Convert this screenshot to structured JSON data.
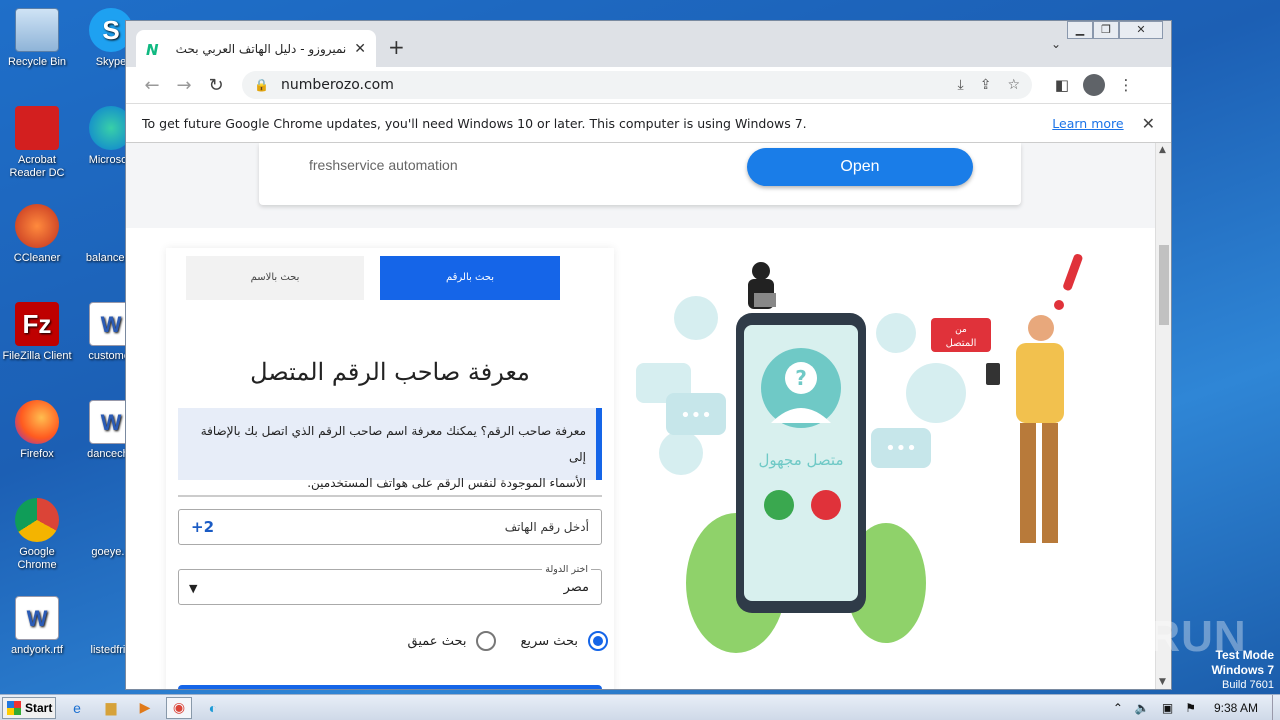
{
  "desktop": {
    "icons": [
      {
        "label": "Recycle Bin"
      },
      {
        "label": "Skype"
      },
      {
        "label": "Acrobat Reader DC"
      },
      {
        "label": "Microsoft"
      },
      {
        "label": "CCleaner"
      },
      {
        "label": "balanceco"
      },
      {
        "label": "FileZilla Client"
      },
      {
        "label": "customer"
      },
      {
        "label": "Firefox"
      },
      {
        "label": "danceche"
      },
      {
        "label": "Google Chrome"
      },
      {
        "label": "goeye.p"
      },
      {
        "label": "andyork.rtf"
      },
      {
        "label": "listedfrid"
      }
    ]
  },
  "browser": {
    "tab_title": "نميروزو - دليل الهاتف العربي بحث بالا",
    "tab_favicon": "N",
    "url": "numberozo.com",
    "infobar": {
      "message": "To get future Google Chrome updates, you'll need Windows 10 or later. This computer is using Windows 7.",
      "link": "Learn more"
    }
  },
  "ad": {
    "text": "freshservice automation",
    "button": "Open"
  },
  "search_card": {
    "tab_by_name": "بحث بالاسم",
    "tab_by_number": "بحث بالرقم",
    "heading": "معرفة صاحب الرقم المتصل",
    "info_line1": "معرفة صاحب الرقم؟ يمكنك معرفة اسم صاحب الرقم الذي اتصل بك بالإضافة إلى",
    "info_line2": "الأسماء الموجودة لنفس الرقم على هواتف المستخدمين.",
    "phone_placeholder": "أدخل رقم الهاتف",
    "phone_code": "+2",
    "country_label": "اختر الدولة",
    "country_value": "مصر",
    "radio_quick": "بحث سريع",
    "radio_deep": "بحث عميق",
    "selected_mode": "quick"
  },
  "illustration": {
    "phone_label": "متصل مجهول",
    "bubble_label_line1": "من",
    "bubble_label_line2": "المتصل"
  },
  "taskbar": {
    "start_label": "Start",
    "clock": "9:38 AM"
  },
  "os_watermark": {
    "line1": "Test Mode",
    "line2": "Windows 7",
    "line3": "Build 7601",
    "brand": "ANY RUN"
  },
  "colors": {
    "accent_blue": "#1565e8",
    "ad_button": "#1a7de8",
    "illustration_teal": "#6fc9c6",
    "alert_red": "#e0323a"
  }
}
